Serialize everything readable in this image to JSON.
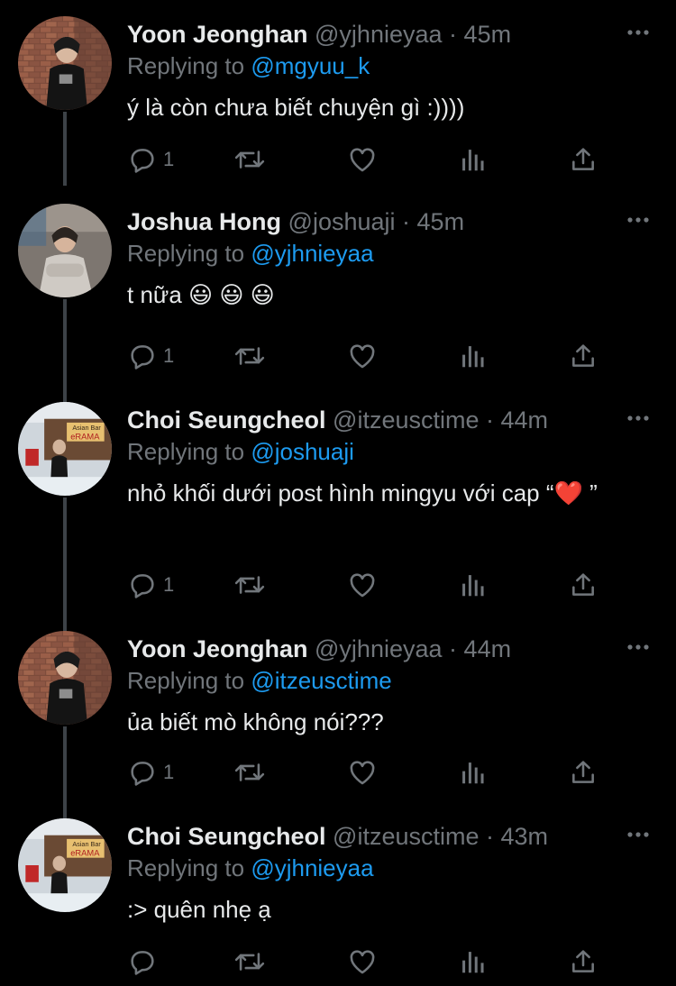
{
  "tweets": [
    {
      "name": "Yoon Jeonghan",
      "handle": "@yjhnieyaa",
      "time": "45m",
      "reply_prefix": "Replying to",
      "reply_handle": "@mgyuu_k",
      "text": "ý là còn chưa biết chuyện gì :))))",
      "reply_count": "1",
      "avatar": "avatar-jeonghan"
    },
    {
      "name": "Joshua Hong",
      "handle": "@joshuaji",
      "time": "45m",
      "reply_prefix": "Replying to",
      "reply_handle": "@yjhnieyaa",
      "text": "t nữa 😃 😃 😃",
      "reply_count": "1",
      "avatar": "avatar-joshua"
    },
    {
      "name": "Choi Seungcheol",
      "handle": "@itzeusctime",
      "time": "44m",
      "reply_prefix": "Replying to",
      "reply_handle": "@joshuaji",
      "text": "nhỏ khối dưới post hình mingyu với cap “❤️ ”",
      "reply_count": "1",
      "avatar": "avatar-seungcheol"
    },
    {
      "name": "Yoon Jeonghan",
      "handle": "@yjhnieyaa",
      "time": "44m",
      "reply_prefix": "Replying to",
      "reply_handle": "@itzeusctime",
      "text": "ủa biết mò không nói???",
      "reply_count": "1",
      "avatar": "avatar-jeonghan"
    },
    {
      "name": "Choi Seungcheol",
      "handle": "@itzeusctime",
      "time": "43m",
      "reply_prefix": "Replying to",
      "reply_handle": "@yjhnieyaa",
      "text": ":> quên nhẹ ạ",
      "reply_count": "",
      "avatar": "avatar-seungcheol"
    }
  ],
  "icons": {
    "reply": "reply-icon",
    "retweet": "retweet-icon",
    "like": "heart-icon",
    "analytics": "analytics-icon",
    "share": "share-icon",
    "more": "more-icon"
  },
  "colors": {
    "background": "#000000",
    "name": "#e7e9ea",
    "meta": "#71767b",
    "link": "#1d9bf0"
  }
}
